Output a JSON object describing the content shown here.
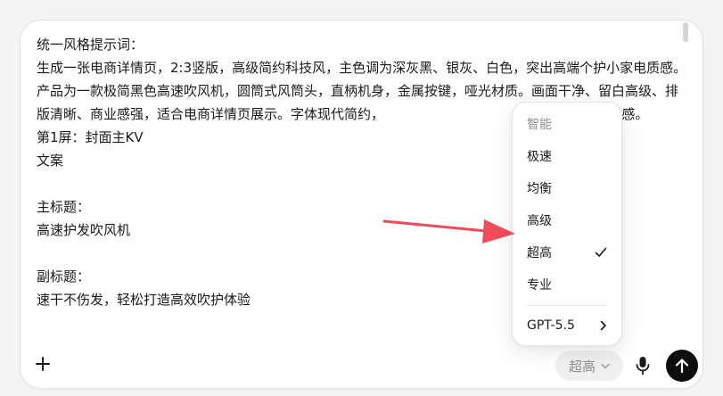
{
  "prompt": {
    "text": "统一风格提示词：\n生成一张电商详情页，2:3竖版，高级简约科技风，主色调为深灰黑、银灰、白色，突出高端个护小家电质感。产品为一款极简黑色高速吹风机，圆筒式风筒头，直柄机身，金属按键，哑光材质。画面干净、留白高级、排版清晰、商业感强，适合电商详情页展示。字体现代简约，                                     科技感与品质感。\n第1屏：封面主KV\n文案\n\n主标题：\n高速护发吹风机\n\n副标题：\n速干不伤发，轻松打造高效吹护体验"
  },
  "toolbar": {
    "model_label": "超高"
  },
  "menu": {
    "header": "智能",
    "items": [
      {
        "label": "极速",
        "selected": false
      },
      {
        "label": "均衡",
        "selected": false
      },
      {
        "label": "高级",
        "selected": false
      },
      {
        "label": "超高",
        "selected": true
      },
      {
        "label": "专业",
        "selected": false
      }
    ],
    "model_item": {
      "label": "GPT-5.5"
    }
  },
  "colors": {
    "accent_arrow": "#ee4b5b",
    "send_button": "#0d0d0d"
  }
}
